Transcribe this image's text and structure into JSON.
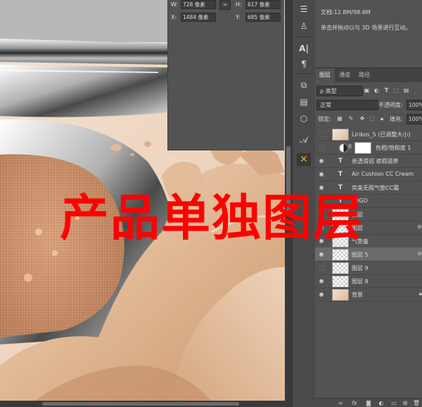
{
  "colors": {
    "panel": "#535353",
    "panel_dark": "#424242",
    "selected_row": "#6a6a6a",
    "overlay_red": "#ff0000",
    "canvas_skin": "#f0dcc9"
  },
  "info_panel": {
    "w_label": "W:",
    "w_value": "728 像素",
    "h_label": "H:",
    "h_value": "617 像素",
    "x_label": "X:",
    "x_value": "1484 像素",
    "y_label": "Y:",
    "y_value": "685 像素",
    "link_icon": "chain-link-icon"
  },
  "doc_info": {
    "size": "文档:12.8M/98.6M",
    "hint": "单击并拖动以与 3D 场景进行互动。"
  },
  "layers_panel": {
    "tabs": [
      {
        "label": "图层",
        "active": true
      },
      {
        "label": "通道",
        "active": false
      },
      {
        "label": "路径",
        "active": false
      }
    ],
    "filter_kind": "ρ 类型",
    "blend_mode": "正常",
    "opacity_label": "不透明度:",
    "opacity_value": "100%",
    "lock_label": "锁定:",
    "fill_label": "填充:",
    "fill_value": "100%",
    "layers": [
      {
        "name": "Lirikos_5 (已调整大小)",
        "kind": "smart",
        "visible": false
      },
      {
        "name": "色相/饱和度 1",
        "kind": "adjustment",
        "visible": false
      },
      {
        "name": "亲透滑润 遮瑕滋养",
        "kind": "text",
        "visible": true
      },
      {
        "name": "Air Cushion CC Cream",
        "kind": "text",
        "visible": true
      },
      {
        "name": "完美无瑕气垫CC霜",
        "kind": "text",
        "visible": true
      },
      {
        "name": "LOGO",
        "kind": "text",
        "visible": true
      },
      {
        "name": "图层",
        "kind": "pixel",
        "visible": true
      },
      {
        "name": "图层",
        "kind": "pixel",
        "visible": true,
        "linked": true
      },
      {
        "name": "气垫盒",
        "kind": "pixel",
        "visible": true
      },
      {
        "name": "图层 5",
        "kind": "pixel",
        "visible": true,
        "selected": true,
        "linked": true
      },
      {
        "name": "图层 9",
        "kind": "pixel",
        "visible": false
      },
      {
        "name": "图层 8",
        "kind": "pixel",
        "visible": true
      },
      {
        "name": "背景",
        "kind": "background",
        "visible": true
      }
    ]
  },
  "overlay": {
    "text": "产品单独图层"
  }
}
